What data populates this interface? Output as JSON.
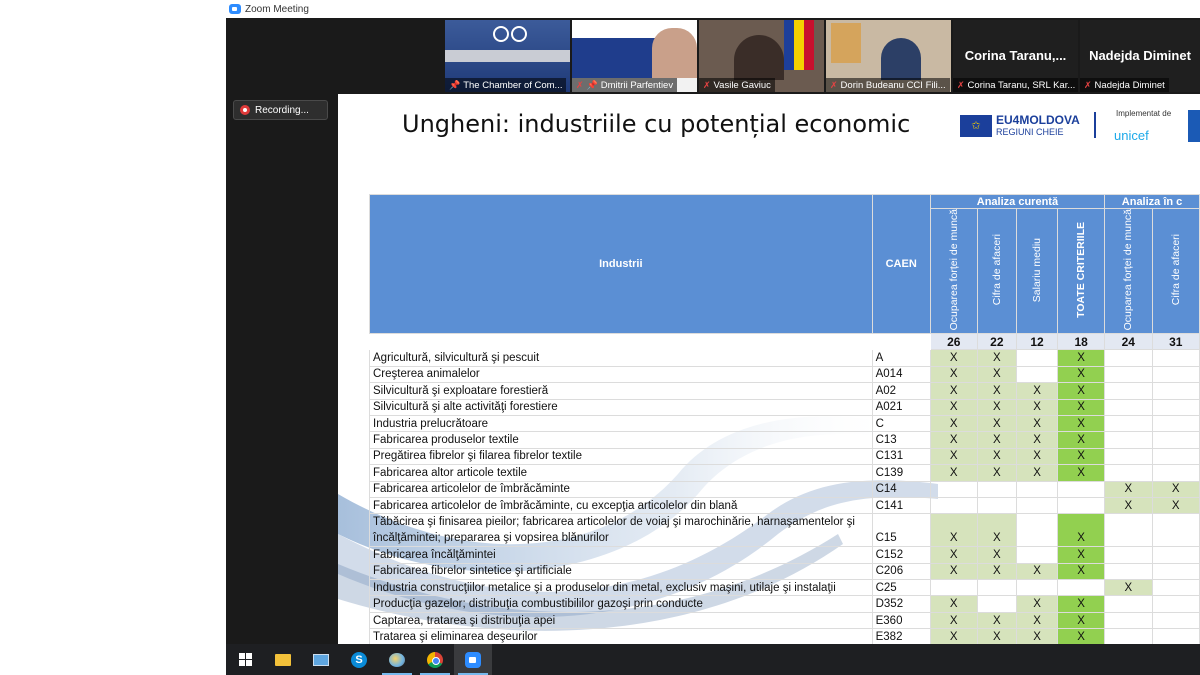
{
  "window": {
    "title": "Zoom Meeting"
  },
  "recording": {
    "label": "Recording..."
  },
  "participants": [
    {
      "name": "The Chamber of Com...",
      "muted": false,
      "pinned": true
    },
    {
      "name": "Dmitrii Parfentiev",
      "muted": true,
      "pinned": true
    },
    {
      "name": "Vasile Gaviuc",
      "muted": true,
      "pinned": false
    },
    {
      "name": "Dorin Budeanu CCI Fili...",
      "muted": true,
      "pinned": false
    },
    {
      "name": "Corina Taranu, SRL Kar...",
      "display": "Corina Taranu,...",
      "muted": true,
      "pinned": false
    },
    {
      "name": "Nadejda Diminet",
      "display": "Nadejda Diminet",
      "muted": true,
      "pinned": false
    }
  ],
  "slide": {
    "title": "Ungheni: industriile cu potențial economic",
    "logo_line1": "EU4MOLDOVA",
    "logo_line2": "REGIUNI CHEIE",
    "implemented_by": "Implementat de",
    "partner": "unicef",
    "table": {
      "header_industrii": "Industrii",
      "header_caen": "CAEN",
      "group1": "Analiza curentă",
      "group2": "Analiza în c",
      "columns": [
        "Ocuparea forței de muncă",
        "Cifra de afaceri",
        "Salariu mediu",
        "TOATE CRITERIILE",
        "Ocuparea forței de muncă",
        "Cifra de afaceri"
      ],
      "counts": [
        "26",
        "22",
        "12",
        "18",
        "24",
        "31"
      ],
      "rows": [
        {
          "name": "Agricultură, silvicultură şi pescuit",
          "caen": "A",
          "marks": [
            "X",
            "X",
            "",
            "X",
            "",
            ""
          ]
        },
        {
          "name": "Creşterea animalelor",
          "caen": "A014",
          "marks": [
            "X",
            "X",
            "",
            "X",
            "",
            ""
          ]
        },
        {
          "name": "Silvicultură şi exploatare forestieră",
          "caen": "A02",
          "marks": [
            "X",
            "X",
            "X",
            "X",
            "",
            ""
          ]
        },
        {
          "name": "Silvicultură şi alte activităţi forestiere",
          "caen": "A021",
          "marks": [
            "X",
            "X",
            "X",
            "X",
            "",
            ""
          ]
        },
        {
          "name": "Industria prelucrătoare",
          "caen": "C",
          "marks": [
            "X",
            "X",
            "X",
            "X",
            "",
            ""
          ]
        },
        {
          "name": "Fabricarea produselor textile",
          "caen": "C13",
          "marks": [
            "X",
            "X",
            "X",
            "X",
            "",
            ""
          ]
        },
        {
          "name": "Pregătirea fibrelor şi filarea fibrelor textile",
          "caen": "C131",
          "marks": [
            "X",
            "X",
            "X",
            "X",
            "",
            ""
          ]
        },
        {
          "name": "Fabricarea altor articole textile",
          "caen": "C139",
          "marks": [
            "X",
            "X",
            "X",
            "X",
            "",
            ""
          ]
        },
        {
          "name": "Fabricarea articolelor de îmbrăcăminte",
          "caen": "C14",
          "marks": [
            "",
            "",
            "",
            "",
            "X",
            "X"
          ]
        },
        {
          "name": "Fabricarea articolelor de îmbrăcăminte, cu excepţia articolelor din blană",
          "caen": "C141",
          "marks": [
            "",
            "",
            "",
            "",
            "X",
            "X"
          ]
        },
        {
          "name": "Tăbăcirea şi finisarea pieilor; fabricarea articolelor de voiaj şi marochinărie, harnaşamentelor şi încălţămintei; prepararea şi vopsirea blănurilor",
          "caen": "C15",
          "marks": [
            "X",
            "X",
            "",
            "X",
            "",
            ""
          ],
          "tall": true
        },
        {
          "name": "Fabricarea încălţămintei",
          "caen": "C152",
          "marks": [
            "X",
            "X",
            "",
            "X",
            "",
            ""
          ]
        },
        {
          "name": "Fabricarea fibrelor sintetice şi artificiale",
          "caen": "C206",
          "marks": [
            "X",
            "X",
            "X",
            "X",
            "",
            ""
          ]
        },
        {
          "name": "Industria construcţiilor metalice şi a produselor din metal, exclusiv maşini, utilaje şi instalaţii",
          "caen": "C25",
          "marks": [
            "",
            "",
            "",
            "",
            "X",
            ""
          ]
        },
        {
          "name": "Producţia gazelor; distribuţia combustibililor gazoşi prin conducte",
          "caen": "D352",
          "marks": [
            "X",
            "",
            "X",
            "X",
            "",
            ""
          ]
        },
        {
          "name": "Captarea, tratarea şi distribuţia apei",
          "caen": "E360",
          "marks": [
            "X",
            "X",
            "X",
            "X",
            "",
            ""
          ]
        },
        {
          "name": "Tratarea şi eliminarea deşeurilor",
          "caen": "E382",
          "marks": [
            "X",
            "X",
            "X",
            "X",
            "",
            ""
          ]
        }
      ]
    }
  },
  "taskbar": {
    "items": [
      "windows-start",
      "file-explorer",
      "monitor-app",
      "skype",
      "paint",
      "chrome",
      "zoom"
    ],
    "active": [
      "zoom"
    ]
  }
}
